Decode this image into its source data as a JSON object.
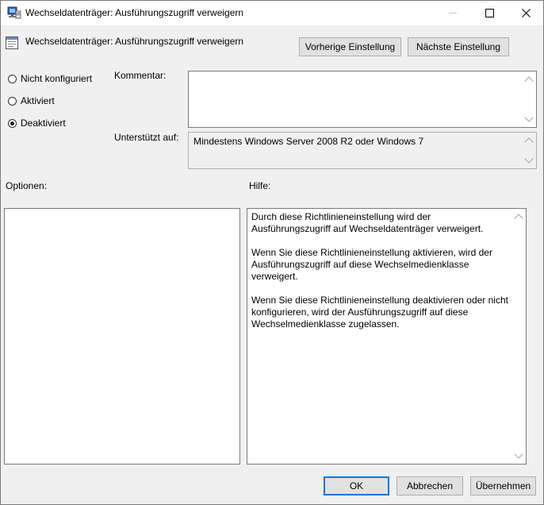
{
  "window": {
    "title": "Wechseldatenträger: Ausführungszugriff verweigern",
    "icons": {
      "app": "policy-app-icon",
      "minimize": "minimize-icon",
      "maximize": "maximize-icon",
      "close": "close-icon"
    }
  },
  "header": {
    "policy_title": "Wechseldatenträger: Ausführungszugriff verweigern",
    "prev_label": "Vorherige Einstellung",
    "next_label": "Nächste Einstellung"
  },
  "state": {
    "options": [
      {
        "label": "Nicht konfiguriert",
        "selected": false
      },
      {
        "label": "Aktiviert",
        "selected": false
      },
      {
        "label": "Deaktiviert",
        "selected": true
      }
    ]
  },
  "comment": {
    "label": "Kommentar:",
    "value": ""
  },
  "supported": {
    "label": "Unterstützt auf:",
    "value": "Mindestens Windows Server 2008 R2 oder Windows 7"
  },
  "options_label": "Optionen:",
  "help": {
    "label": "Hilfe:",
    "paragraphs": [
      "Durch diese Richtlinieneinstellung wird der Ausführungszugriff auf Wechseldatenträger verweigert.",
      "Wenn Sie diese Richtlinieneinstellung aktivieren, wird der Ausführungszugriff auf diese Wechselmedienklasse verweigert.",
      "Wenn Sie diese Richtlinieneinstellung deaktivieren oder nicht konfigurieren, wird der Ausführungszugriff auf diese Wechselmedienklasse zugelassen."
    ]
  },
  "footer": {
    "ok": "OK",
    "cancel": "Abbrechen",
    "apply": "Übernehmen"
  },
  "colors": {
    "accent": "#0078d7",
    "background": "#f0f0f0",
    "titlebar": "#ffffff"
  }
}
